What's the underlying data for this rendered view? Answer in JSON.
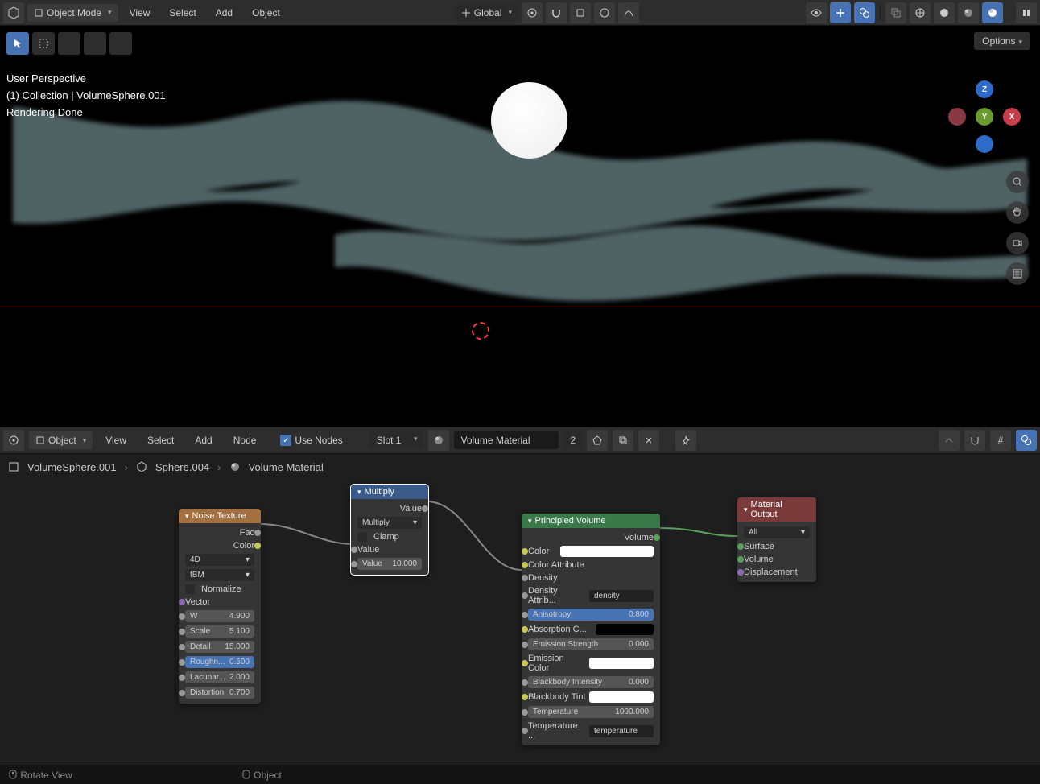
{
  "header": {
    "mode": "Object Mode",
    "menus": [
      "View",
      "Select",
      "Add",
      "Object"
    ],
    "orientation": "Global"
  },
  "viewport": {
    "info_line1": "User Perspective",
    "info_line2": "(1) Collection | VolumeSphere.001",
    "info_line3": "Rendering Done",
    "options": "Options"
  },
  "node_header": {
    "mode": "Object",
    "menus": [
      "View",
      "Select",
      "Add",
      "Node"
    ],
    "use_nodes": "Use Nodes",
    "slot": "Slot 1",
    "material": "Volume Material",
    "users": "2"
  },
  "breadcrumb": {
    "obj": "VolumeSphere.001",
    "mesh": "Sphere.004",
    "mat": "Volume Material"
  },
  "nodes": {
    "noise": {
      "title": "Noise Texture",
      "out_fac": "Fac",
      "out_color": "Color",
      "dim": "4D",
      "type": "fBM",
      "normalize": "Normalize",
      "vector": "Vector",
      "w_l": "W",
      "w_v": "4.900",
      "scale_l": "Scale",
      "scale_v": "5.100",
      "detail_l": "Detail",
      "detail_v": "15.000",
      "rough_l": "Roughn...",
      "rough_v": "0.500",
      "lac_l": "Lacunar...",
      "lac_v": "2.000",
      "dist_l": "Distortion",
      "dist_v": "0.700"
    },
    "multiply": {
      "title": "Multiply",
      "out": "Value",
      "op": "Multiply",
      "clamp": "Clamp",
      "in1": "Value",
      "in2_l": "Value",
      "in2_v": "10.000"
    },
    "pvol": {
      "title": "Principled Volume",
      "out": "Volume",
      "color": "Color",
      "color_attr": "Color Attribute",
      "density": "Density",
      "density_attr_l": "Density Attrib...",
      "density_attr_v": "density",
      "aniso_l": "Anisotropy",
      "aniso_v": "0.800",
      "absorb": "Absorption C...",
      "em_str_l": "Emission Strength",
      "em_str_v": "0.000",
      "em_color": "Emission Color",
      "bb_int_l": "Blackbody Intensity",
      "bb_int_v": "0.000",
      "bb_tint": "Blackbody Tint",
      "temp_l": "Temperature",
      "temp_v": "1000.000",
      "temp_attr_l": "Temperature ...",
      "temp_attr_v": "temperature"
    },
    "output": {
      "title": "Material Output",
      "target": "All",
      "surface": "Surface",
      "volume": "Volume",
      "disp": "Displacement"
    }
  },
  "footer": {
    "left": "Rotate View",
    "right": "Object"
  }
}
